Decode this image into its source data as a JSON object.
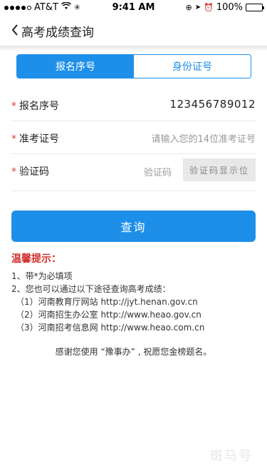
{
  "status_bar": {
    "carrier": "AT&T",
    "time": "9:41 AM",
    "battery": "100%"
  },
  "nav": {
    "title": "高考成绩查询"
  },
  "tabs": [
    {
      "label": "报名序号",
      "active": true
    },
    {
      "label": "身份证号",
      "active": false
    }
  ],
  "form": {
    "registration": {
      "label": "报名序号",
      "value": "123456789012"
    },
    "admission": {
      "label": "准考证号",
      "placeholder": "请输入您的14位准考证号"
    },
    "captcha": {
      "label": "验证码",
      "placeholder": "验证码",
      "box_text": "验证码显示位"
    }
  },
  "query_button": "查询",
  "tips": {
    "title": "温馨提示：",
    "lines": [
      "1、带*为必填项",
      "2、您也可以通过以下途径查询高考成绩：",
      "（1）河南教育厅网站 http://jyt.henan.gov.cn",
      "（2）河南招生办公室 http://www.heao.gov.cn",
      "（3）河南招考信息网 http://www.heao.com.cn"
    ]
  },
  "thanks": "感谢您使用 “豫事办” , 祝愿您金榜题名。",
  "watermark": "斑马号",
  "colors": {
    "primary": "#1e8fe8",
    "required_star": "#e23b3b",
    "tips_title": "#d0312d"
  }
}
